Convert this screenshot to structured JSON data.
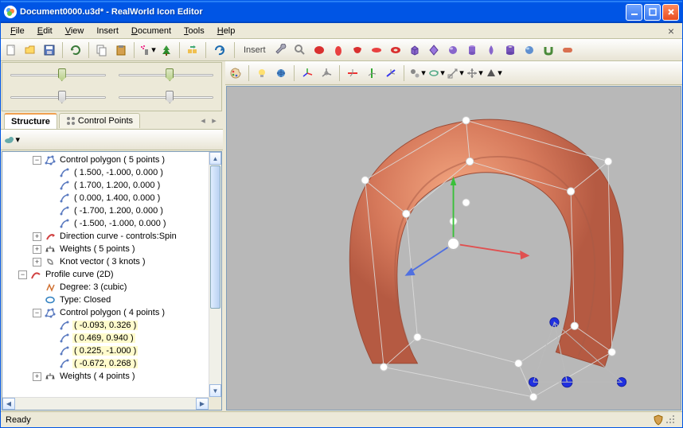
{
  "window": {
    "title": "Document0000.u3d* - RealWorld Icon Editor"
  },
  "menu": {
    "file": "File",
    "edit": "Edit",
    "view": "View",
    "insert": "Insert",
    "document": "Document",
    "tools": "Tools",
    "help": "Help"
  },
  "toolbar_main": {
    "new": "new-doc",
    "open": "open-folder",
    "save": "save-disk",
    "undo_history": "history",
    "copy": "copy",
    "paste": "paste-brush",
    "spray": "spray",
    "tree": "tree-green",
    "batch": "batch",
    "redo": "redo"
  },
  "toolbar_insert": {
    "label": "Insert",
    "items": [
      "wrench",
      "magnifier",
      "red-blob",
      "egg",
      "bean",
      "disc",
      "torus",
      "cube",
      "diamond",
      "sphere",
      "cylinder",
      "drop",
      "tube",
      "sphere2",
      "ushape",
      "pill"
    ]
  },
  "toolbar_view": {
    "items": [
      "palette",
      "bulb",
      "globe",
      "axis1",
      "axis2",
      "axis3",
      "axis4",
      "axis5",
      "gears",
      "rotate",
      "scale",
      "move",
      "pyramid"
    ]
  },
  "tabs": {
    "structure": "Structure",
    "control_points": "Control Points"
  },
  "tree": {
    "nodes": [
      {
        "depth": 2,
        "exp": "-",
        "icon": "poly",
        "label": "Control polygon ( 5 points )"
      },
      {
        "depth": 3,
        "exp": "",
        "icon": "pt",
        "label": "( 1.500, -1.000, 0.000 )"
      },
      {
        "depth": 3,
        "exp": "",
        "icon": "pt",
        "label": "( 1.700, 1.200, 0.000 )"
      },
      {
        "depth": 3,
        "exp": "",
        "icon": "pt",
        "label": "( 0.000, 1.400, 0.000 )"
      },
      {
        "depth": 3,
        "exp": "",
        "icon": "pt",
        "label": "( -1.700, 1.200, 0.000 )"
      },
      {
        "depth": 3,
        "exp": "",
        "icon": "pt",
        "label": "( -1.500, -1.000, 0.000 )"
      },
      {
        "depth": 2,
        "exp": "+",
        "icon": "spin",
        "label": "Direction curve - controls:Spin"
      },
      {
        "depth": 2,
        "exp": "+",
        "icon": "weight",
        "label": "Weights ( 5 points )"
      },
      {
        "depth": 2,
        "exp": "+",
        "icon": "knot",
        "label": "Knot vector ( 3 knots )"
      },
      {
        "depth": 1,
        "exp": "-",
        "icon": "curve",
        "label": "Profile curve (2D)"
      },
      {
        "depth": 2,
        "exp": "",
        "icon": "degree",
        "label": "Degree: 3 (cubic)"
      },
      {
        "depth": 2,
        "exp": "",
        "icon": "type",
        "label": "Type: Closed"
      },
      {
        "depth": 2,
        "exp": "-",
        "icon": "poly",
        "label": "Control polygon ( 4 points )"
      },
      {
        "depth": 3,
        "exp": "",
        "icon": "pt",
        "label": "( -0.093, 0.326 )",
        "hl": true
      },
      {
        "depth": 3,
        "exp": "",
        "icon": "pt",
        "label": "( 0.469, 0.940 )",
        "hl": true
      },
      {
        "depth": 3,
        "exp": "",
        "icon": "pt",
        "label": "( 0.225, -1.000 )",
        "hl": true
      },
      {
        "depth": 3,
        "exp": "",
        "icon": "pt",
        "label": "( -0.672, 0.268 )",
        "hl": true
      },
      {
        "depth": 2,
        "exp": "+",
        "icon": "weight",
        "label": "Weights ( 4 points )"
      }
    ]
  },
  "status": {
    "text": "Ready"
  }
}
